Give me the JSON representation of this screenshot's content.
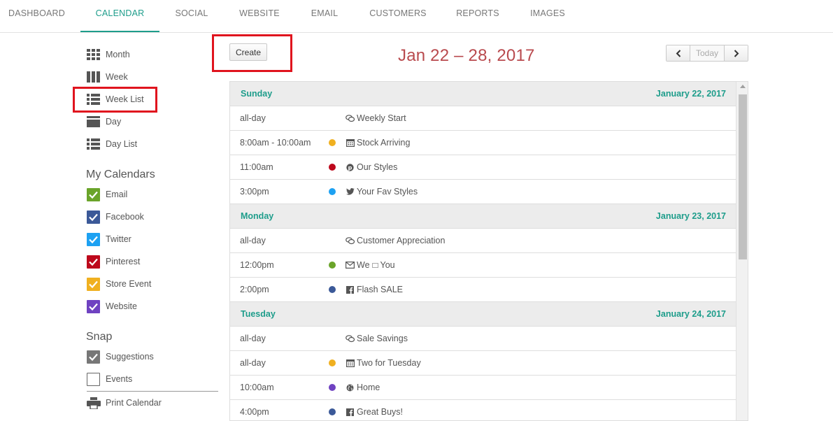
{
  "nav": {
    "tabs": [
      {
        "label": "DASHBOARD"
      },
      {
        "label": "CALENDAR"
      },
      {
        "label": "SOCIAL"
      },
      {
        "label": "WEBSITE"
      },
      {
        "label": "EMAIL"
      },
      {
        "label": "CUSTOMERS"
      },
      {
        "label": "REPORTS"
      },
      {
        "label": "IMAGES"
      }
    ],
    "active": "CALENDAR",
    "accent": "#1e9d8b"
  },
  "views": [
    {
      "label": "Month",
      "icon": "month-grid-icon"
    },
    {
      "label": "Week",
      "icon": "week-columns-icon"
    },
    {
      "label": "Week List",
      "icon": "week-list-icon"
    },
    {
      "label": "Day",
      "icon": "day-icon"
    },
    {
      "label": "Day List",
      "icon": "day-list-icon"
    }
  ],
  "my_calendars": {
    "title": "My Calendars",
    "items": [
      {
        "label": "Email",
        "color": "#6aa42a",
        "checked": true
      },
      {
        "label": "Facebook",
        "color": "#3b5998",
        "checked": true
      },
      {
        "label": "Twitter",
        "color": "#1da1f2",
        "checked": true
      },
      {
        "label": "Pinterest",
        "color": "#bd081c",
        "checked": true
      },
      {
        "label": "Store Event",
        "color": "#f0b020",
        "checked": true
      },
      {
        "label": "Website",
        "color": "#6f42c1",
        "checked": true
      }
    ]
  },
  "snap": {
    "title": "Snap",
    "items": [
      {
        "label": "Suggestions",
        "color": "#777777",
        "checked": true
      },
      {
        "label": "Events",
        "checked": false
      }
    ]
  },
  "print_label": "Print Calendar",
  "create_label": "Create",
  "range_title": "Jan 22 – 28, 2017",
  "today_label": "Today",
  "days": [
    {
      "name": "Sunday",
      "date": "January 22, 2017",
      "events": [
        {
          "time": "all-day",
          "dot": null,
          "icon": "chat-bubbles-icon",
          "title": "Weekly Start"
        },
        {
          "time": "8:00am - 10:00am",
          "dot": "#f0b020",
          "icon": "calendar-icon",
          "title": "Stock Arriving"
        },
        {
          "time": "11:00am",
          "dot": "#bd081c",
          "icon": "pinterest-icon",
          "title": "Our Styles"
        },
        {
          "time": "3:00pm",
          "dot": "#1da1f2",
          "icon": "twitter-icon",
          "title": "Your Fav Styles"
        }
      ]
    },
    {
      "name": "Monday",
      "date": "January 23, 2017",
      "events": [
        {
          "time": "all-day",
          "dot": null,
          "icon": "chat-bubbles-icon",
          "title": "Customer Appreciation"
        },
        {
          "time": "12:00pm",
          "dot": "#6aa42a",
          "icon": "envelope-icon",
          "title": "We",
          "title2": "You",
          "glyph_box": true
        },
        {
          "time": "2:00pm",
          "dot": "#3b5998",
          "icon": "facebook-icon",
          "title": "Flash SALE"
        }
      ]
    },
    {
      "name": "Tuesday",
      "date": "January 24, 2017",
      "events": [
        {
          "time": "all-day",
          "dot": null,
          "icon": "chat-bubbles-icon",
          "title": "Sale Savings"
        },
        {
          "time": "all-day",
          "dot": "#f0b020",
          "icon": "calendar-icon",
          "title": "Two for Tuesday"
        },
        {
          "time": "10:00am",
          "dot": "#6f42c1",
          "icon": "globe-icon",
          "title": "Home"
        },
        {
          "time": "4:00pm",
          "dot": "#3b5998",
          "icon": "facebook-icon",
          "title": "Great Buys!"
        }
      ]
    }
  ]
}
